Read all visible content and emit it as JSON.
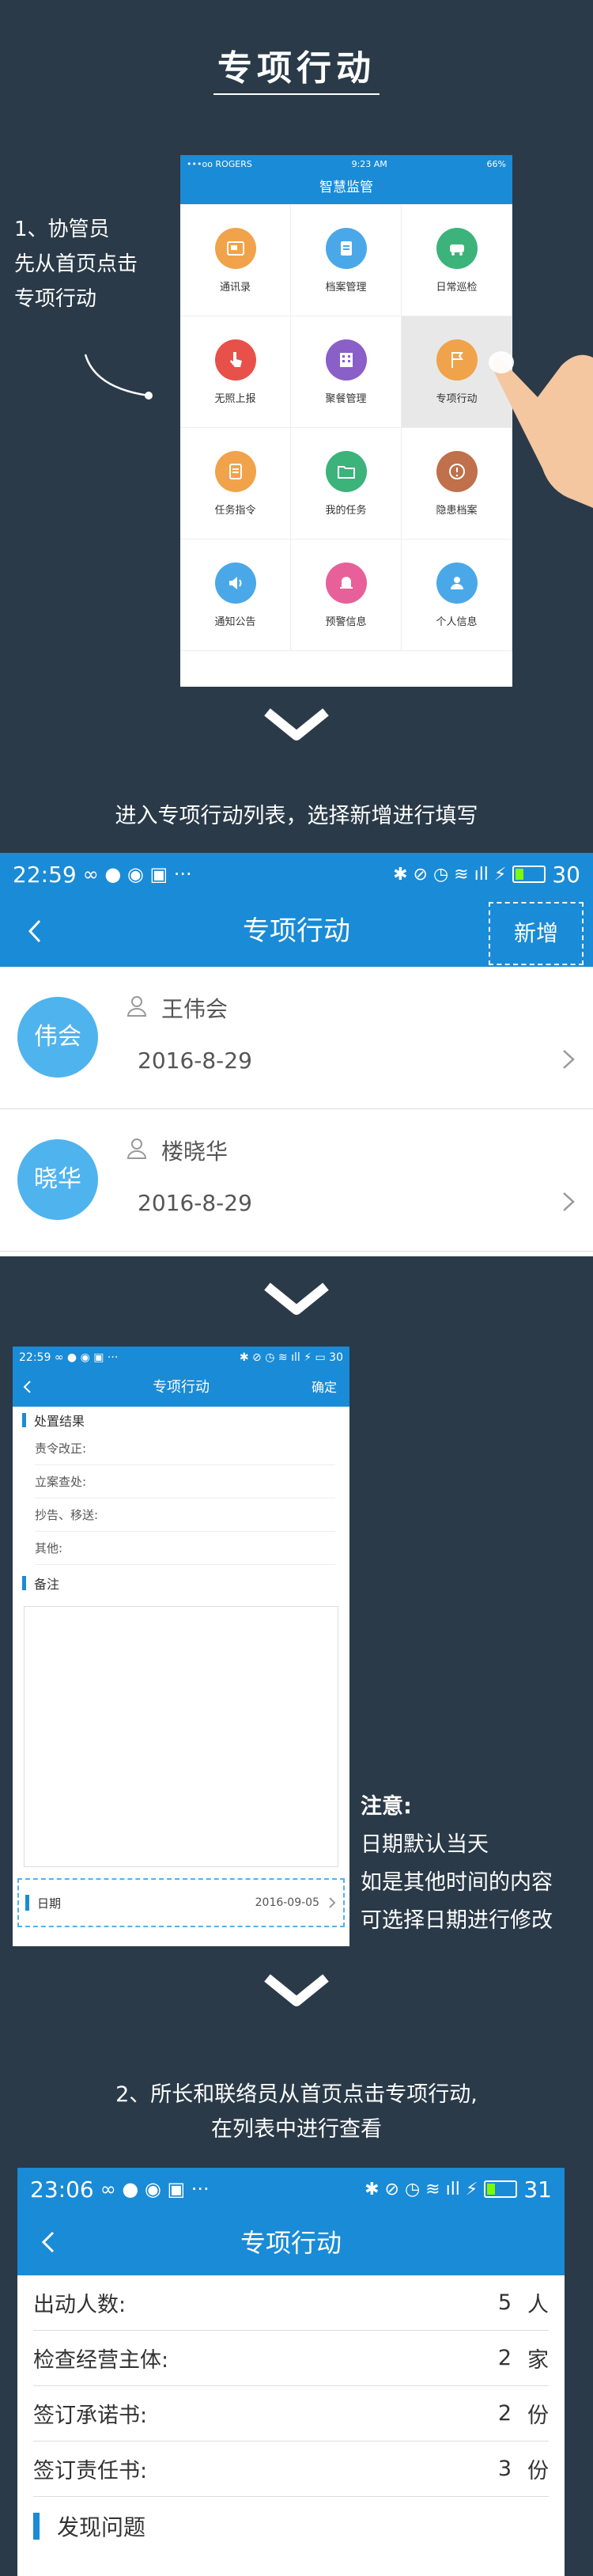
{
  "title": "专项行动",
  "step1": {
    "lines": [
      "1、协管员",
      "先从首页点击",
      "专项行动"
    ]
  },
  "phone1": {
    "status": {
      "carrier": "•••oo ROGERS",
      "time": "9:23 AM",
      "battery": "66%"
    },
    "nav_title": "智慧监管",
    "grid": [
      {
        "label": "通讯录",
        "icon": "contacts-icon",
        "color": "#f0a34a"
      },
      {
        "label": "档案管理",
        "icon": "clipboard-icon",
        "color": "#4aa8e8"
      },
      {
        "label": "日常巡检",
        "icon": "car-icon",
        "color": "#3bb37a"
      },
      {
        "label": "无照上报",
        "icon": "pointer-icon",
        "color": "#e8504a"
      },
      {
        "label": "聚餐管理",
        "icon": "building-icon",
        "color": "#8a5fc8"
      },
      {
        "label": "专项行动",
        "icon": "flag-icon",
        "color": "#f0a34a"
      },
      {
        "label": "任务指令",
        "icon": "task-icon",
        "color": "#f0a34a"
      },
      {
        "label": "我的任务",
        "icon": "folder-icon",
        "color": "#3bb37a"
      },
      {
        "label": "隐患档案",
        "icon": "alert-icon",
        "color": "#c0704a"
      },
      {
        "label": "通知公告",
        "icon": "speaker-icon",
        "color": "#4aa8e8"
      },
      {
        "label": "预警信息",
        "icon": "bell-icon",
        "color": "#e8609a"
      },
      {
        "label": "个人信息",
        "icon": "person-icon",
        "color": "#4aa8e8"
      }
    ]
  },
  "step2_text": "进入专项行动列表，选择新增进行填写",
  "phone2": {
    "status": {
      "time": "22:59",
      "battery": "30"
    },
    "nav_title": "专项行动",
    "new_label": "新增",
    "rows": [
      {
        "avatar": "伟会",
        "name": "王伟会",
        "date": "2016-8-29"
      },
      {
        "avatar": "晓华",
        "name": "楼晓华",
        "date": "2016-8-29"
      }
    ]
  },
  "phone3": {
    "status": {
      "time": "22:59",
      "battery": "30"
    },
    "nav_title": "专项行动",
    "confirm": "确定",
    "section1": "处置结果",
    "fields": [
      "责令改正:",
      "立案查处:",
      "抄告、移送:",
      "其他:"
    ],
    "section2": "备注",
    "date_label": "日期",
    "date_value": "2016-09-05"
  },
  "note": {
    "title": "注意:",
    "lines": [
      "日期默认当天",
      "如是其他时间的内容",
      "可选择日期进行修改"
    ]
  },
  "step3": {
    "lines": [
      "2、所长和联络员从首页点击专项行动,",
      "在列表中进行查看"
    ]
  },
  "phone4": {
    "status": {
      "time": "23:06",
      "battery": "31"
    },
    "nav_title": "专项行动",
    "rows": [
      {
        "label": "出动人数:",
        "value": "5",
        "unit": "人"
      },
      {
        "label": "检查经营主体:",
        "value": "2",
        "unit": "家"
      },
      {
        "label": "签订承诺书:",
        "value": "2",
        "unit": "份"
      },
      {
        "label": "签订责任书:",
        "value": "3",
        "unit": "份"
      }
    ],
    "section": "发现问题"
  }
}
